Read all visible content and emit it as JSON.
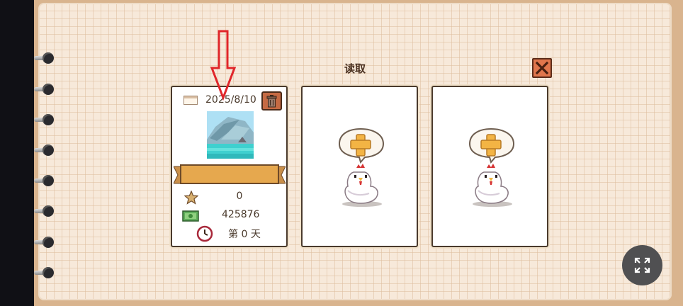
{
  "dialog": {
    "title": "读取"
  },
  "slots": [
    {
      "state": "filled",
      "date": "2025/8/10",
      "stars": "0",
      "money": "425876",
      "day": "第 0 天"
    },
    {
      "state": "empty"
    },
    {
      "state": "empty"
    }
  ],
  "icons": {
    "close": "close-icon",
    "delete": "trash-icon",
    "calendar": "calendar-icon",
    "star": "star-icon",
    "money": "money-icon",
    "clock": "clock-icon",
    "add": "plus-icon",
    "fullscreen": "fullscreen-icon"
  },
  "colors": {
    "accent_orange": "#e0764c",
    "paper": "#f7e9da",
    "ribbon": "#e6a84e",
    "annotation_arrow": "#e0262a"
  }
}
